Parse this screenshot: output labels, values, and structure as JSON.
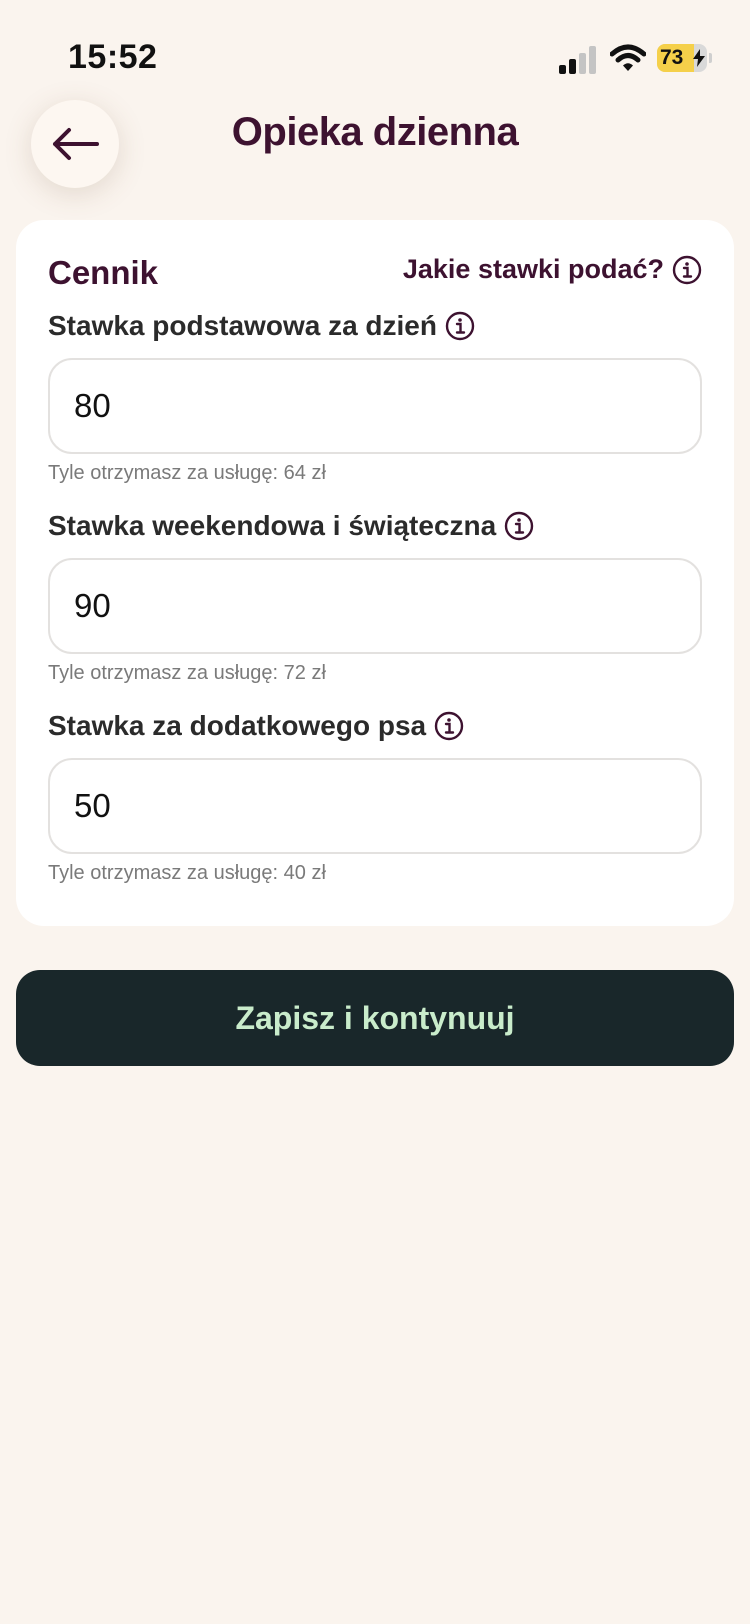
{
  "status_bar": {
    "time": "15:52",
    "battery_percent": 73,
    "battery_label": "73",
    "signal_bars_active": 2,
    "signal_bars_total": 4
  },
  "header": {
    "title": "Opieka dzienna",
    "back_icon": "arrow-left-icon"
  },
  "pricing": {
    "section_title": "Cennik",
    "help_link_label": "Jakie stawki podać?",
    "fields": [
      {
        "label": "Stawka podstawowa za dzień",
        "value": "80",
        "hint": "Tyle otrzymasz za usługę: 64 zł"
      },
      {
        "label": "Stawka weekendowa i świąteczna",
        "value": "90",
        "hint": "Tyle otrzymasz za usługę: 72 zł"
      },
      {
        "label": "Stawka za dodatkowego psa",
        "value": "50",
        "hint": "Tyle otrzymasz za usługę: 40 zł"
      }
    ]
  },
  "actions": {
    "save_label": "Zapisz i kontynuuj"
  },
  "colors": {
    "background": "#FAF4EE",
    "brand_plum": "#3D1230",
    "button_dark": "#19272A",
    "button_text": "#C9ECCB",
    "battery_fill": "#F5D04A"
  }
}
